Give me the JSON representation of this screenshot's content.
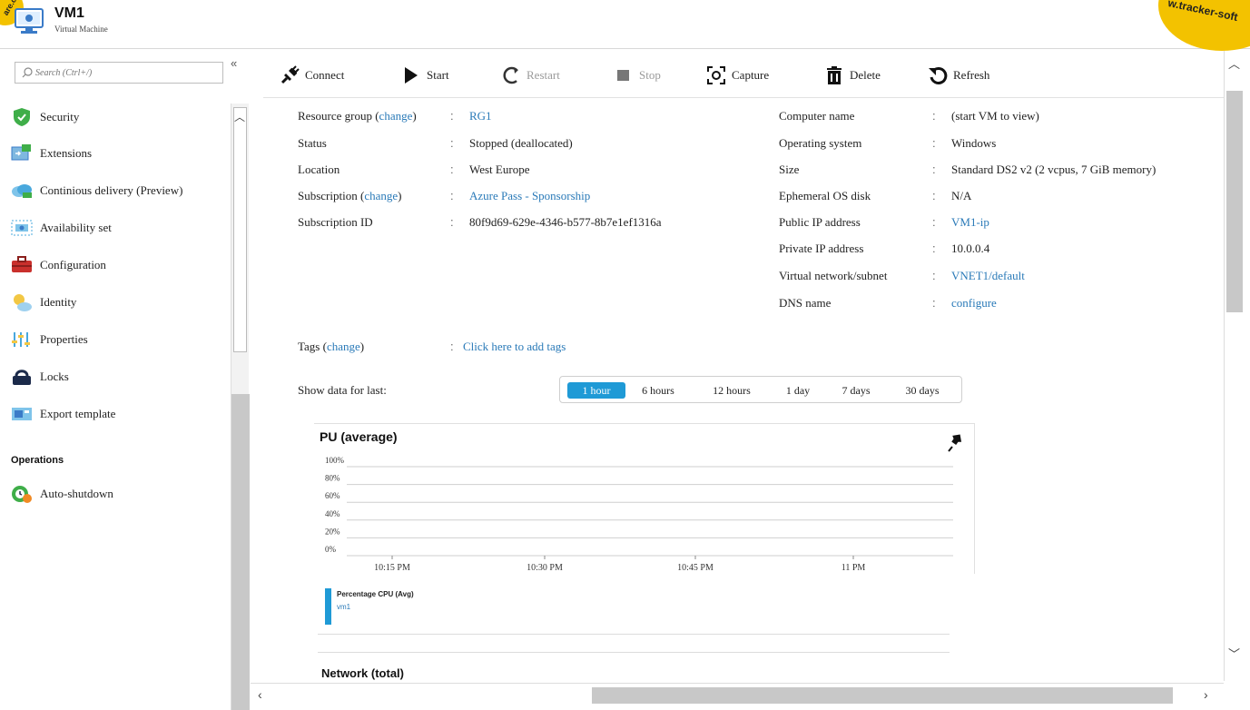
{
  "header": {
    "title": "VM1",
    "subtitle": "Virtual Machine",
    "watermark_left": "are.c",
    "watermark_right": "w.tracker-soft"
  },
  "sidebar": {
    "search_placeholder": "Search (Ctrl+/)",
    "collapse_label": "«",
    "items": [
      {
        "label": "Security",
        "icon": "shield-icon"
      },
      {
        "label": "Extensions",
        "icon": "extensions-icon"
      },
      {
        "label": "Continious delivery (Preview)",
        "icon": "cloud-delivery-icon"
      },
      {
        "label": "Availability set",
        "icon": "availability-set-icon"
      },
      {
        "label": "Configuration",
        "icon": "toolbox-icon"
      },
      {
        "label": "Identity",
        "icon": "identity-icon"
      },
      {
        "label": "Properties",
        "icon": "properties-icon"
      },
      {
        "label": "Locks",
        "icon": "lock-icon"
      },
      {
        "label": "Export template",
        "icon": "export-template-icon"
      }
    ],
    "section_label": "Operations",
    "operations_items": [
      {
        "label": "Auto-shutdown",
        "icon": "auto-shutdown-icon"
      }
    ]
  },
  "toolbar": {
    "connect": "Connect",
    "start": "Start",
    "restart": "Restart",
    "stop": "Stop",
    "capture": "Capture",
    "delete": "Delete",
    "refresh": "Refresh"
  },
  "essentials": {
    "left": [
      {
        "label": "Resource group",
        "label_link": "change",
        "value": "RG1",
        "value_is_link": true
      },
      {
        "label": "Status",
        "value": "Stopped (deallocated)"
      },
      {
        "label": "Location",
        "value": "West Europe"
      },
      {
        "label": "Subscription",
        "label_link": "change",
        "value": "Azure Pass - Sponsorship",
        "value_is_link": true
      },
      {
        "label": "Subscription ID",
        "value": "80f9d69-629e-4346-b577-8b7e1ef1316a"
      }
    ],
    "right": [
      {
        "label": "Computer name",
        "value": "(start VM to view)"
      },
      {
        "label": "Operating system",
        "value": "Windows"
      },
      {
        "label": "Size",
        "value": "Standard DS2 v2 (2 vcpus, 7 GiB memory)"
      },
      {
        "label": "Ephemeral OS disk",
        "value": "N/A"
      },
      {
        "label": "Public IP address",
        "value": "VM1-ip",
        "value_is_link": true
      },
      {
        "label": "Private IP address",
        "value": "10.0.0.4"
      },
      {
        "label": "Virtual network/subnet",
        "value": "VNET1/default",
        "value_is_link": true
      },
      {
        "label": "DNS name",
        "value": "configure",
        "value_is_link": true
      }
    ],
    "separator": ":",
    "tags_label": "Tags",
    "tags_change": "change",
    "tags_value": "Click here to add tags"
  },
  "time_range": {
    "label": "Show data for last:",
    "options": [
      "1 hour",
      "6 hours",
      "12 hours",
      "1 day",
      "7 days",
      "30 days"
    ],
    "selected": "1 hour"
  },
  "chart_data": {
    "type": "line",
    "title": "PU (average)",
    "y_ticks": [
      "100%",
      "80%",
      "60%",
      "40%",
      "20%",
      "0%"
    ],
    "ylim": [
      0,
      100
    ],
    "x_ticks": [
      "10:15 PM",
      "10:30 PM",
      "10:45 PM",
      "11 PM"
    ],
    "grid": true,
    "series": [
      {
        "name": "Percentage CPU (Avg)",
        "sub": "vm1",
        "values": []
      }
    ],
    "color": "#1f9ad6"
  },
  "next_chart": {
    "title": "Network (total)"
  },
  "colors": {
    "accent": "#1f9ad6",
    "link": "#2a7ab8"
  }
}
